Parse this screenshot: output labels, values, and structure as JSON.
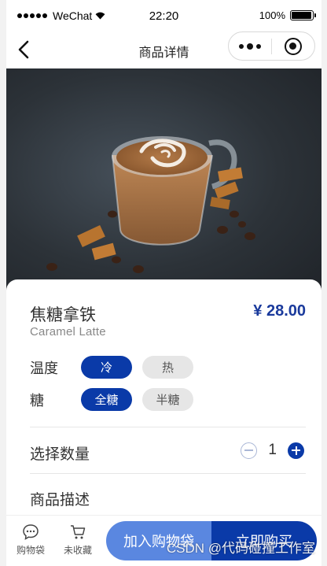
{
  "status_bar": {
    "carrier": "WeChat",
    "time": "22:20",
    "battery": "100%"
  },
  "nav": {
    "title": "商品详情"
  },
  "product": {
    "name_cn": "焦糖拿铁",
    "name_en": "Caramel Latte",
    "price": "¥ 28.00"
  },
  "options": {
    "temperature": {
      "label": "温度",
      "choices": [
        "冷",
        "热"
      ],
      "selected": "冷"
    },
    "sugar": {
      "label": "糖",
      "choices": [
        "全糖",
        "半糖"
      ],
      "selected": "全糖"
    }
  },
  "quantity": {
    "label": "选择数量",
    "value": "1"
  },
  "description": {
    "label": "商品描述"
  },
  "bottom": {
    "cart_tool": "购物袋",
    "favorite_tool": "未收藏",
    "add_to_cart": "加入购物袋",
    "buy_now": "立即购买"
  },
  "watermark": "CSDN @代码碰撞工作室",
  "colors": {
    "primary": "#0a3aa8",
    "secondary": "#5a87e0",
    "chip_off": "#e6e6e6"
  }
}
